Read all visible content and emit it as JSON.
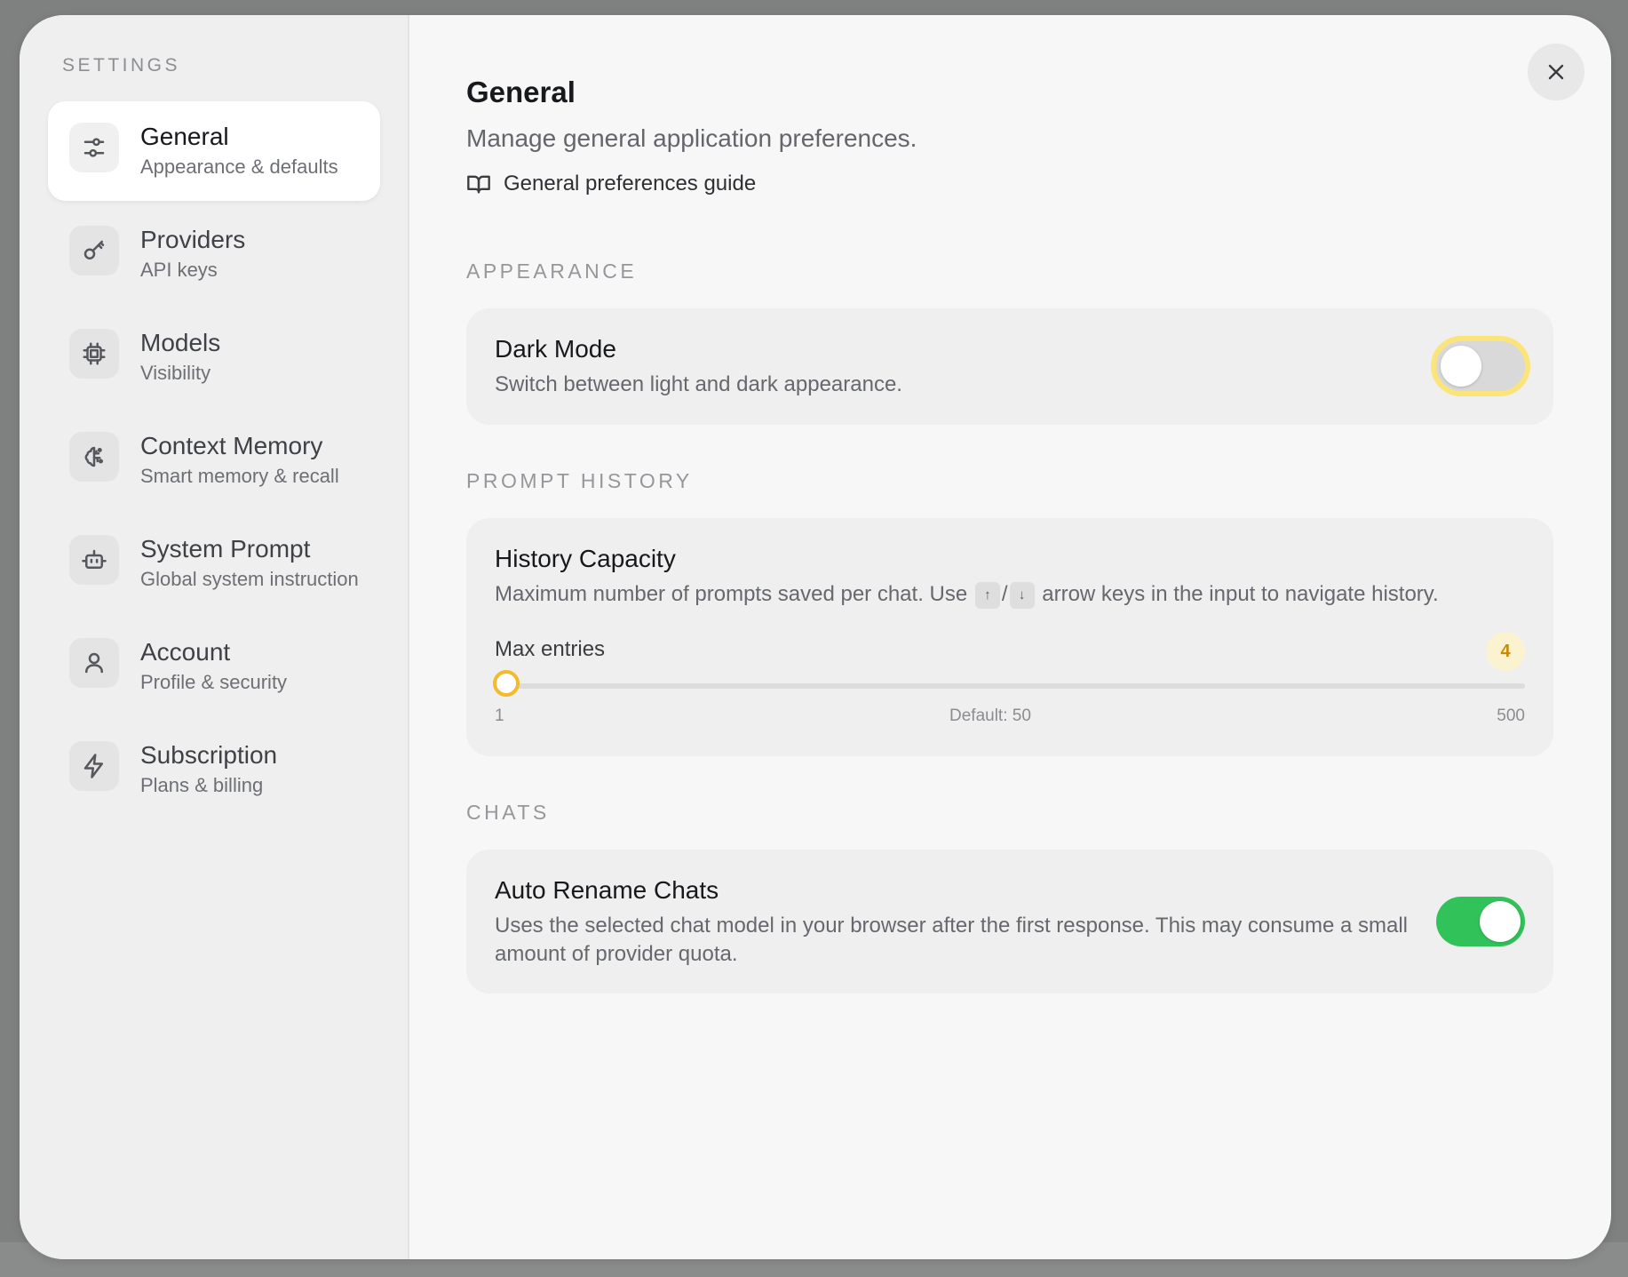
{
  "sidebar": {
    "title": "SETTINGS",
    "items": [
      {
        "label": "General",
        "sub": "Appearance & defaults",
        "icon": "sliders-icon",
        "active": true
      },
      {
        "label": "Providers",
        "sub": "API keys",
        "icon": "key-icon",
        "active": false
      },
      {
        "label": "Models",
        "sub": "Visibility",
        "icon": "cpu-icon",
        "active": false
      },
      {
        "label": "Context Memory",
        "sub": "Smart memory & recall",
        "icon": "brain-icon",
        "active": false
      },
      {
        "label": "System Prompt",
        "sub": "Global system instruction",
        "icon": "bot-icon",
        "active": false
      },
      {
        "label": "Account",
        "sub": "Profile & security",
        "icon": "user-icon",
        "active": false
      },
      {
        "label": "Subscription",
        "sub": "Plans & billing",
        "icon": "zap-icon",
        "active": false
      }
    ]
  },
  "header": {
    "title": "General",
    "subtitle": "Manage general application preferences.",
    "guide_link": "General preferences guide"
  },
  "appearance": {
    "section_title": "APPEARANCE",
    "dark_mode": {
      "title": "Dark Mode",
      "description": "Switch between light and dark appearance.",
      "enabled": false
    }
  },
  "prompt_history": {
    "section_title": "PROMPT HISTORY",
    "title": "History Capacity",
    "description_before": "Maximum number of prompts saved per chat. Use",
    "key_up": "↑",
    "key_separator": "/",
    "key_down": "↓",
    "description_after": "arrow keys in the input to navigate history.",
    "slider_label": "Max entries",
    "value": "4",
    "min_label": "1",
    "default_label": "Default: 50",
    "max_label": "500",
    "min": 1,
    "max": 500,
    "current": 4
  },
  "chats": {
    "section_title": "CHATS",
    "auto_rename": {
      "title": "Auto Rename Chats",
      "description": "Uses the selected chat model in your browser after the first response. This may consume a small amount of provider quota.",
      "enabled": true
    }
  },
  "colors": {
    "accent_yellow": "#f2bb2c",
    "toggle_on": "#32c25a",
    "badge_text": "#c88a06"
  }
}
